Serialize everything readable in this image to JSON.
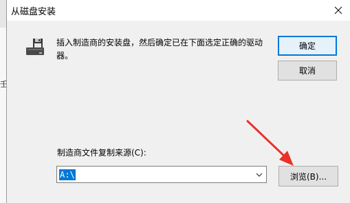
{
  "dialog": {
    "title": "从磁盘安装",
    "message": "插入制造商的安装盘，然后确定已在下面选定正确的驱动器。",
    "ok_label": "确定",
    "cancel_label": "取消",
    "source_label": "制造商文件复制来源(C):",
    "source_value": "A:\\",
    "browse_label": "浏览(B)..."
  },
  "background": {
    "partial_char": "壬"
  },
  "colors": {
    "accent": "#0078d7",
    "annotation_arrow": "#e8322a",
    "dialog_bg": "#f0f0f0"
  },
  "icons": [
    "close-icon",
    "floppy-disk-icon",
    "chevron-down-icon",
    "annotation-arrow-icon"
  ]
}
